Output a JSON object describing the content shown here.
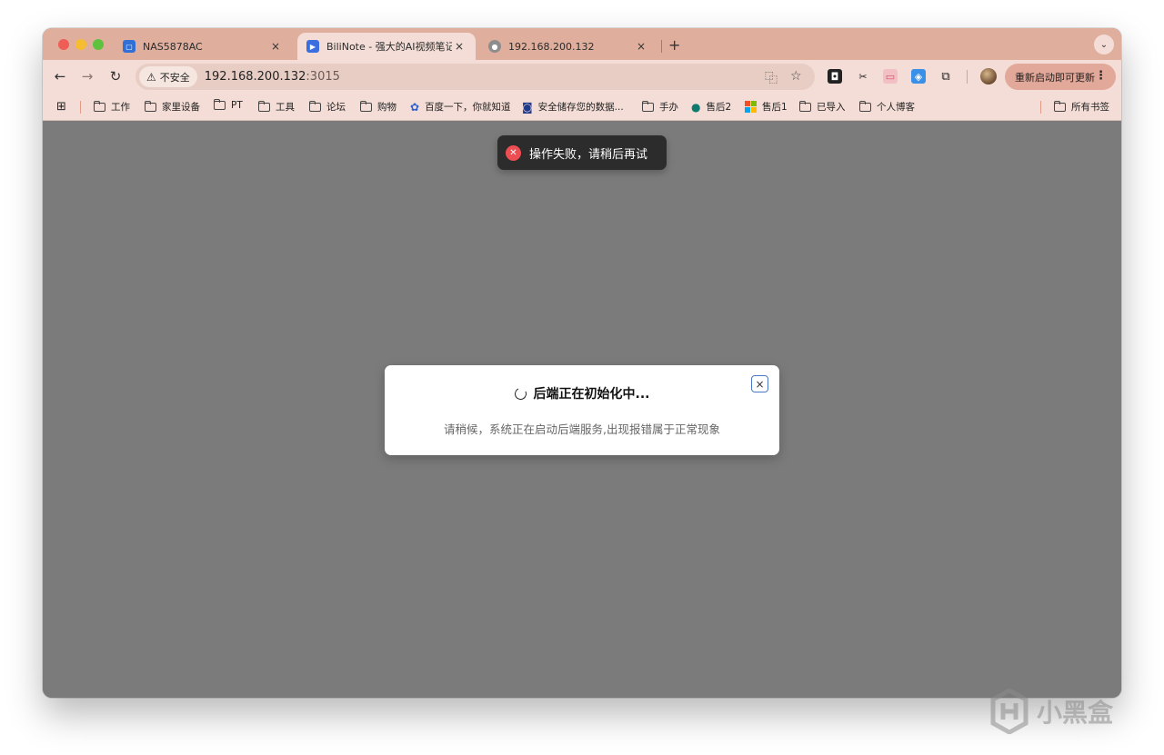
{
  "tabs": [
    {
      "title": "NAS5878AC",
      "favicon": "qnap-icon",
      "active": false
    },
    {
      "title": "BiliNote - 强大的AI视频笔记神器",
      "favicon": "bilinote-icon",
      "active": true
    },
    {
      "title": "192.168.200.132",
      "favicon": "globe-icon",
      "active": false
    }
  ],
  "tab_close_glyph": "×",
  "new_tab_glyph": "+",
  "address": {
    "security_label": "不安全",
    "host": "192.168.200.132",
    "port": ":3015"
  },
  "update_button": {
    "label": "重新启动即可更新"
  },
  "bookmarks": [
    {
      "label": "工作",
      "type": "folder"
    },
    {
      "label": "家里设备",
      "type": "folder"
    },
    {
      "label": "PT",
      "type": "folder"
    },
    {
      "label": "工具",
      "type": "folder"
    },
    {
      "label": "论坛",
      "type": "folder"
    },
    {
      "label": "购物",
      "type": "folder"
    },
    {
      "label": "百度一下，你就知道",
      "type": "link",
      "icon": "baidu-icon"
    },
    {
      "label": "安全储存您的数据...",
      "type": "link",
      "icon": "storage-icon"
    },
    {
      "label": "手办",
      "type": "folder"
    },
    {
      "label": "售后2",
      "type": "link",
      "icon": "sharepoint-icon"
    },
    {
      "label": "售后1",
      "type": "link",
      "icon": "microsoft-icon"
    },
    {
      "label": "已导入",
      "type": "folder"
    },
    {
      "label": "个人博客",
      "type": "folder"
    },
    {
      "label": "所有书签",
      "type": "folder"
    }
  ],
  "toast": {
    "message": "操作失败，请稍后再试",
    "icon": "error-icon"
  },
  "modal": {
    "title": "后端正在初始化中...",
    "message": "请稍候，系统正在启动后端服务,出现报错属于正常现象",
    "close_glyph": "×"
  },
  "watermark": {
    "text": "小黑盒"
  },
  "colors": {
    "tabstrip": "#dfae9c",
    "toolbar": "#f3ddd6",
    "overlay": "#7b7b7b",
    "toast_bg": "#2c2c2c",
    "error_red": "#ee4d52",
    "update_button": "#e2a899"
  }
}
